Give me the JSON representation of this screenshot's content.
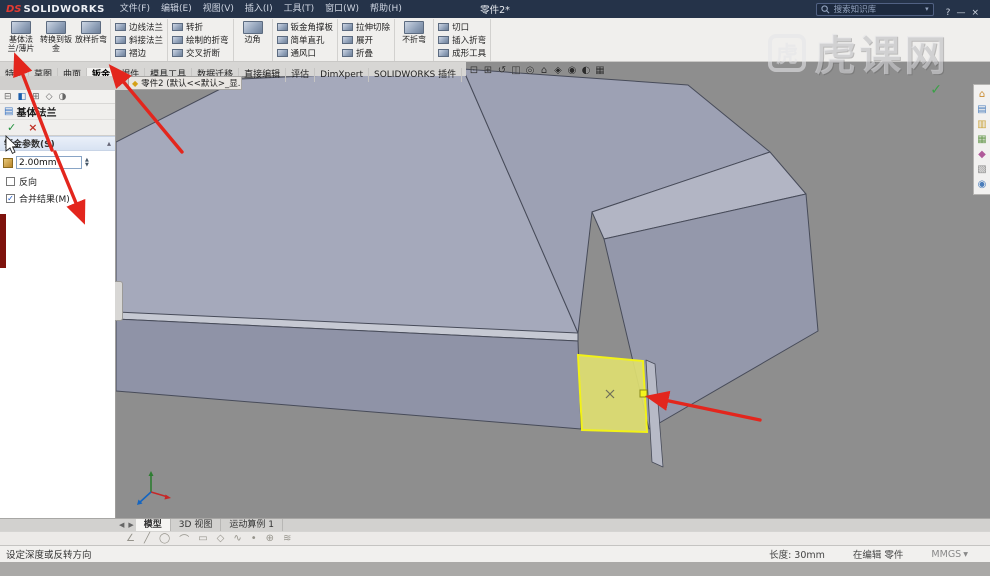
{
  "title_bar": {
    "logo_prefix": "DS",
    "logo_text": "SOLIDWORKS",
    "menus": [
      "文件(F)",
      "编辑(E)",
      "视图(V)",
      "插入(I)",
      "工具(T)",
      "窗口(W)",
      "帮助(H)"
    ],
    "document_title": "零件2*",
    "search_placeholder": "搜索知识库",
    "search_arrow": "▾",
    "window_controls": [
      {
        "name": "help-icon",
        "glyph": "?"
      },
      {
        "name": "minimize-icon",
        "glyph": "—"
      },
      {
        "name": "close-icon",
        "glyph": "×"
      }
    ]
  },
  "ribbon": {
    "groups": [
      {
        "type": "big",
        "items": [
          "基体法兰/薄片",
          "转换到钣金",
          "放样折弯"
        ]
      },
      {
        "type": "stack",
        "items": [
          "边线法兰",
          "斜接法兰",
          "褶边"
        ]
      },
      {
        "type": "stack",
        "items": [
          "转折",
          "绘制的折弯",
          "交叉折断"
        ]
      },
      {
        "type": "big",
        "items": [
          "边角"
        ]
      },
      {
        "type": "stack",
        "items": [
          "钣金角撑板",
          "简单直孔",
          "通风口"
        ]
      },
      {
        "type": "stack",
        "items": [
          "拉伸切除",
          "展开",
          "折叠"
        ]
      },
      {
        "type": "big",
        "items": [
          "不折弯"
        ]
      },
      {
        "type": "stack",
        "items": [
          "切口",
          "插入折弯",
          "成形工具"
        ]
      }
    ]
  },
  "command_tabs": {
    "items": [
      "特征",
      "草图",
      "曲面",
      "钣金",
      "焊件",
      "模具工具",
      "数据迁移",
      "直接编辑",
      "评估",
      "DimXpert",
      "SOLIDWORKS 插件"
    ],
    "active": "钣金"
  },
  "document_tab": {
    "icon_glyph": "◆",
    "label": "零件2 (默认<<默认>_显..."
  },
  "feature_panel": {
    "tabs": [
      {
        "name": "featuremanager-tab-icon",
        "glyph": "⊟"
      },
      {
        "name": "propertymanager-tab-icon",
        "glyph": "◧"
      },
      {
        "name": "configurationmanager-tab-icon",
        "glyph": "⊞"
      },
      {
        "name": "dimxpertmanager-tab-icon",
        "glyph": "◇"
      },
      {
        "name": "displaymanager-tab-icon",
        "glyph": "◑"
      }
    ],
    "title": "基体法兰",
    "ok_glyph": "✓",
    "cancel_glyph": "×",
    "section_header": "钣金参数(S)",
    "collapse_glyph": "▴",
    "thickness_value": "2.00mm",
    "spin_up": "▲",
    "spin_down": "▼",
    "reverse_label": "反向",
    "merge_label": "合并结果(M)",
    "check_glyph": "✓"
  },
  "viewport": {
    "headsup_icons": [
      {
        "name": "zoom-fit-icon",
        "glyph": "⊡"
      },
      {
        "name": "zoom-area-icon",
        "glyph": "⊞"
      },
      {
        "name": "previous-view-icon",
        "glyph": "↺"
      },
      {
        "name": "section-view-icon",
        "glyph": "◫"
      },
      {
        "name": "dynamic-annotation-icon",
        "glyph": "◎"
      },
      {
        "name": "view-orientation-icon",
        "glyph": "⌂"
      },
      {
        "name": "display-style-icon",
        "glyph": "◈"
      },
      {
        "name": "hide-show-items-icon",
        "glyph": "◉"
      },
      {
        "name": "edit-appearance-icon",
        "glyph": "◐"
      },
      {
        "name": "apply-scene-icon",
        "glyph": "▦"
      }
    ],
    "confirmation_glyph": "✓",
    "selected_face_mark": "×"
  },
  "task_pane": {
    "icons": [
      {
        "name": "home-icon",
        "glyph": "⌂",
        "color": "#c98a2f"
      },
      {
        "name": "design-library-icon",
        "glyph": "▤",
        "color": "#4a7dbb"
      },
      {
        "name": "file-explorer-icon",
        "glyph": "▥",
        "color": "#caa43c"
      },
      {
        "name": "view-palette-icon",
        "glyph": "▦",
        "color": "#6a9a52"
      },
      {
        "name": "appearances-icon",
        "glyph": "◆",
        "color": "#b05a9a"
      },
      {
        "name": "custom-properties-icon",
        "glyph": "▧",
        "color": "#888888"
      },
      {
        "name": "forum-icon",
        "glyph": "◉",
        "color": "#4a7dbb"
      }
    ]
  },
  "watermark": {
    "logo_char": "虎",
    "text": "虎课网"
  },
  "bottom_bar": {
    "nav_icons": [
      {
        "name": "scroll-left-icon",
        "glyph": "◀"
      },
      {
        "name": "scroll-right-icon",
        "glyph": "▶"
      }
    ],
    "tabs": [
      "模型",
      "3D 视图",
      "运动算例 1"
    ],
    "active": "模型",
    "sketch_icons": [
      {
        "name": "smart-dimension-icon",
        "glyph": "∠"
      },
      {
        "name": "line-icon",
        "glyph": "╱"
      },
      {
        "name": "circle-icon",
        "glyph": "◯"
      },
      {
        "name": "arc-icon",
        "glyph": "⌒"
      },
      {
        "name": "rectangle-icon",
        "glyph": "▭"
      },
      {
        "name": "polygon-icon",
        "glyph": "◇"
      },
      {
        "name": "spline-icon",
        "glyph": "∿"
      },
      {
        "name": "point-icon",
        "glyph": "•"
      },
      {
        "name": "mirror-icon",
        "glyph": "⊕"
      },
      {
        "name": "trim-icon",
        "glyph": "≋"
      }
    ]
  },
  "status_bar": {
    "message": "设定深度或反转方向",
    "length_label": "长度: 30mm",
    "mode_label": "在编辑 零件",
    "units_label": "MMGS",
    "units_arrow": "▾"
  }
}
